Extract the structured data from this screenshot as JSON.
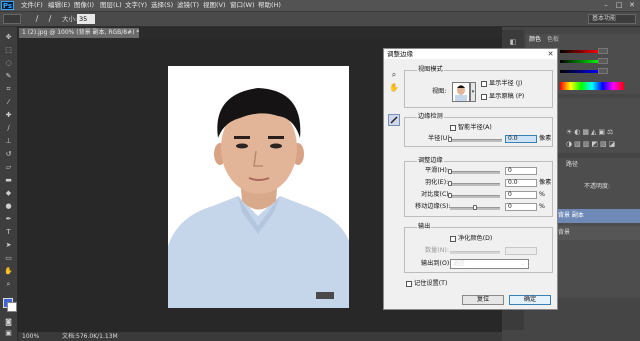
{
  "app": {
    "logo": "Ps"
  },
  "menubar": {
    "items": [
      "文件(F)",
      "编辑(E)",
      "图像(I)",
      "图层(L)",
      "文字(Y)",
      "选择(S)",
      "滤镜(T)",
      "视图(V)",
      "窗口(W)",
      "帮助(H)"
    ],
    "window_buttons": [
      "–",
      "□",
      "✕"
    ]
  },
  "options": {
    "size_label": "大小:",
    "size_value": "35",
    "workspace": "基本功能"
  },
  "document": {
    "tab_title": "1 (2).jpg @ 100% (背景 副本, RGB/8#) *",
    "zoom": "100%",
    "info": "文档:576.0K/1.13M"
  },
  "panels": {
    "color_tab": "颜色",
    "swatches_tab": "色板",
    "paths_tab": "路径",
    "opacity_label": "不透明度:",
    "layer_name": "背景 副本",
    "layer_name_2": "背景"
  },
  "dialog": {
    "title": "调整边缘",
    "close": "✕",
    "view_mode": {
      "group_label": "视图模式",
      "view_label": "视图:",
      "show_radius": "显示半径 (J)",
      "show_original": "显示原稿 (P)",
      "show_radius_checked": false,
      "show_original_checked": false
    },
    "edge_detection": {
      "group_label": "边缘检测",
      "smart_radius": "智能半径(A)",
      "smart_radius_checked": false,
      "radius_label": "半径(U):",
      "radius_value": "0.0",
      "radius_unit": "像素"
    },
    "adjust_edge": {
      "group_label": "调整边缘",
      "smooth_label": "平滑(H):",
      "smooth_value": "0",
      "feather_label": "羽化(E):",
      "feather_value": "0.0",
      "feather_unit": "像素",
      "contrast_label": "对比度(C):",
      "contrast_value": "0",
      "contrast_unit": "%",
      "shift_label": "移动边缘(S):",
      "shift_value": "0",
      "shift_unit": "%"
    },
    "output": {
      "group_label": "输出",
      "decontaminate": "净化颜色(D)",
      "decontaminate_checked": false,
      "amount_label": "数量(N):",
      "output_to_label": "输出到(O):",
      "output_to_value": "选区"
    },
    "remember": "记住设置(T)",
    "remember_checked": false,
    "reset": "复位",
    "ok": "确定"
  },
  "colors": {
    "accent": "#31a8ff",
    "selected_layer": "#6f89b6"
  }
}
